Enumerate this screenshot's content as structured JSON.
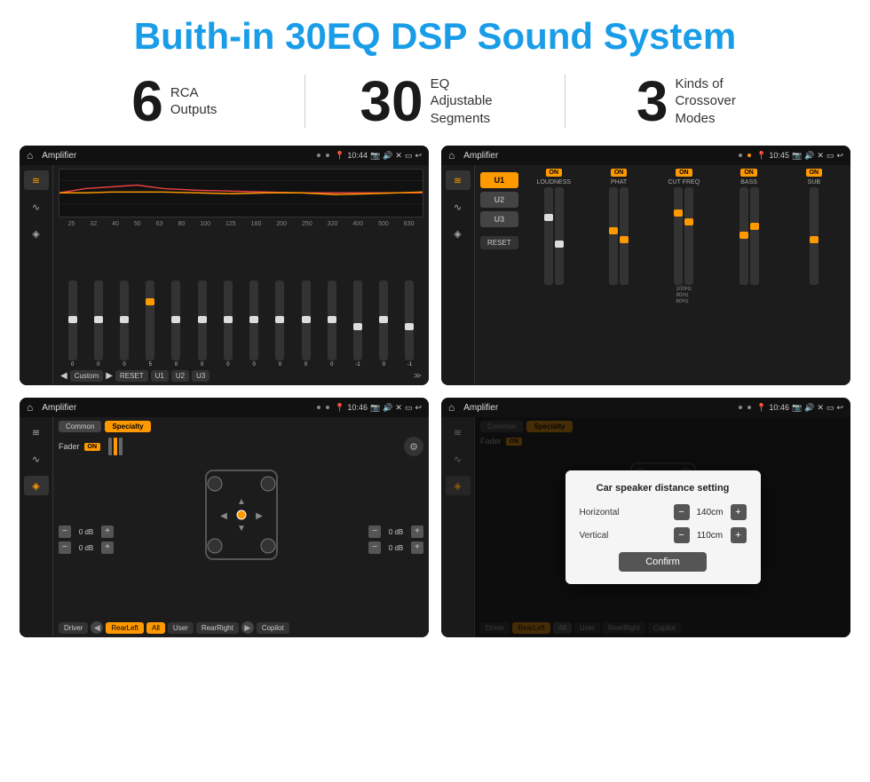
{
  "header": {
    "title": "Buith-in 30EQ DSP Sound System"
  },
  "stats": [
    {
      "number": "6",
      "label": "RCA\nOutputs"
    },
    {
      "number": "30",
      "label": "EQ Adjustable\nSegments"
    },
    {
      "number": "3",
      "label": "Kinds of\nCrossover Modes"
    }
  ],
  "screens": [
    {
      "id": "screen1",
      "title": "Amplifier",
      "time": "10:44",
      "type": "eq"
    },
    {
      "id": "screen2",
      "title": "Amplifier",
      "time": "10:45",
      "type": "crossover"
    },
    {
      "id": "screen3",
      "title": "Amplifier",
      "time": "10:46",
      "type": "fader"
    },
    {
      "id": "screen4",
      "title": "Amplifier",
      "time": "10:46",
      "type": "fader-dialog"
    }
  ],
  "eq": {
    "freq_labels": [
      "25",
      "32",
      "40",
      "50",
      "63",
      "80",
      "100",
      "125",
      "160",
      "200",
      "250",
      "320",
      "400",
      "500",
      "630"
    ],
    "values": [
      "0",
      "0",
      "0",
      "5",
      "0",
      "0",
      "0",
      "0",
      "0",
      "0",
      "0",
      "-1",
      "0",
      "-1"
    ],
    "buttons": [
      "Custom",
      "RESET",
      "U1",
      "U2",
      "U3"
    ]
  },
  "crossover": {
    "presets": [
      "U1",
      "U2",
      "U3"
    ],
    "channels": [
      "LOUDNESS",
      "PHAT",
      "CUT FREQ",
      "BASS",
      "SUB"
    ],
    "on_states": [
      true,
      true,
      true,
      true,
      true
    ]
  },
  "fader": {
    "tabs": [
      "Common",
      "Specialty"
    ],
    "label": "Fader",
    "positions": [
      "Driver",
      "RearLeft",
      "All",
      "User",
      "RearRight",
      "Copilot"
    ],
    "db_values": [
      "0 dB",
      "0 dB",
      "0 dB",
      "0 dB"
    ]
  },
  "dialog": {
    "title": "Car speaker distance setting",
    "horizontal_label": "Horizontal",
    "horizontal_value": "140cm",
    "vertical_label": "Vertical",
    "vertical_value": "110cm",
    "confirm_label": "Confirm"
  }
}
